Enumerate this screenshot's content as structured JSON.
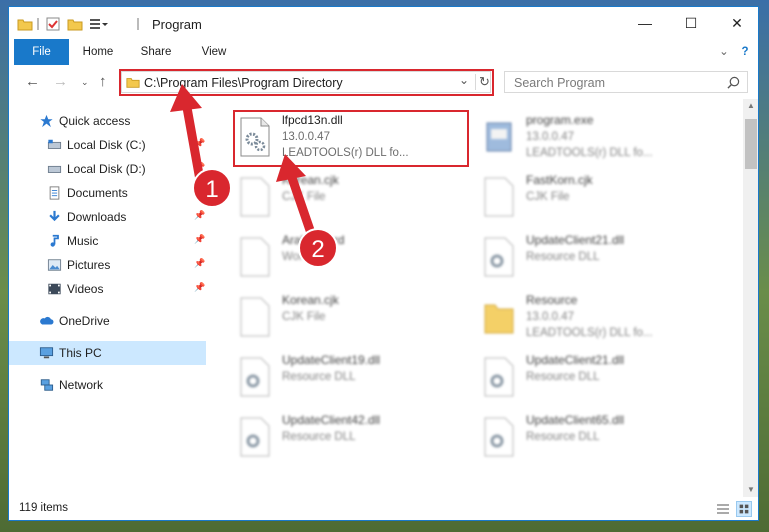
{
  "window": {
    "title": "Program"
  },
  "titlebar": {
    "minimize": "—",
    "maximize": "☐",
    "close": "✕"
  },
  "ribbon": {
    "tabs": [
      "File",
      "Home",
      "Share",
      "View"
    ],
    "expand": "⌄",
    "help": "?"
  },
  "address": {
    "path": "C:\\Program Files\\Program Directory",
    "dropdown": "⌄",
    "refresh": "↻"
  },
  "search": {
    "placeholder": "Search Program"
  },
  "nav": {
    "quick_access": "Quick access",
    "items": [
      {
        "label": "Local Disk (C:)",
        "pinned": true
      },
      {
        "label": "Local Disk (D:)",
        "pinned": true
      },
      {
        "label": "Documents",
        "pinned": true
      },
      {
        "label": "Downloads",
        "pinned": true
      },
      {
        "label": "Music",
        "pinned": true
      },
      {
        "label": "Pictures",
        "pinned": true
      },
      {
        "label": "Videos",
        "pinned": true
      }
    ],
    "onedrive": "OneDrive",
    "this_pc": "This PC",
    "network": "Network"
  },
  "files": [
    {
      "name": "lfpcd13n.dll",
      "type": "13.0.0.47",
      "desc": "LEADTOOLS(r) DLL fo...",
      "highlight": true
    },
    {
      "name": "program.exe",
      "type": "13.0.0.47",
      "desc": "LEADTOOLS(r) DLL fo..."
    },
    {
      "name": "Korean.cjk",
      "type": "CJK File",
      "desc": ""
    },
    {
      "name": "FastKorn.cjk",
      "type": "CJK File",
      "desc": ""
    },
    {
      "name": "ArabicWord",
      "type": "Word",
      "desc": ""
    },
    {
      "name": "UpdateClient21.dll",
      "type": "Resource DLL",
      "desc": ""
    },
    {
      "name": "Korean.cjk",
      "type": "CJK File",
      "desc": ""
    },
    {
      "name": "Resource",
      "type": "13.0.0.47",
      "desc": "LEADTOOLS(r) DLL fo..."
    },
    {
      "name": "UpdateClient19.dll",
      "type": "Resource DLL",
      "desc": ""
    },
    {
      "name": "UpdateClient21.dll",
      "type": "Resource DLL",
      "desc": ""
    },
    {
      "name": "UpdateClient42.dll",
      "type": "Resource DLL",
      "desc": ""
    },
    {
      "name": "UpdateClient65.dll",
      "type": "Resource DLL",
      "desc": ""
    }
  ],
  "status": {
    "item_count": "119 items"
  },
  "callouts": {
    "one": "1",
    "two": "2"
  },
  "colors": {
    "accent": "#1979ca",
    "highlight_box": "#d9272e",
    "callout": "#d9272e"
  }
}
